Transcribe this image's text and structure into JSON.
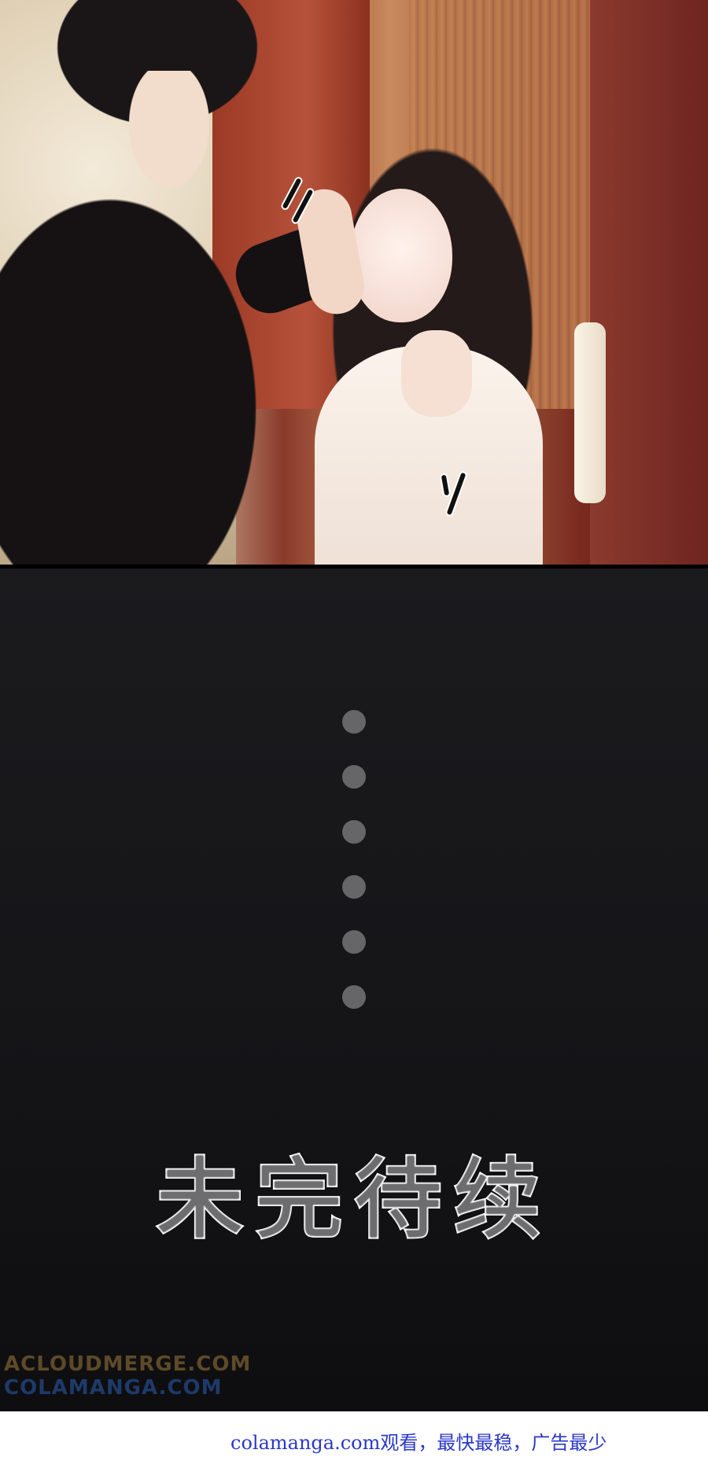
{
  "photo_panel": {
    "sfx_marks": [
      "//",
      "//"
    ]
  },
  "dots_count": 6,
  "ending_title": "未完待续",
  "watermark": {
    "line1": "ACLOUDMERGE.COM",
    "line2": "COLAMANGA.COM"
  },
  "footer": {
    "text": "colamanga.com观看，最快最稳，广告最少"
  },
  "colors": {
    "dark_bg": "#151518",
    "dot": "#666669",
    "footer_text": "#2a38c8"
  }
}
